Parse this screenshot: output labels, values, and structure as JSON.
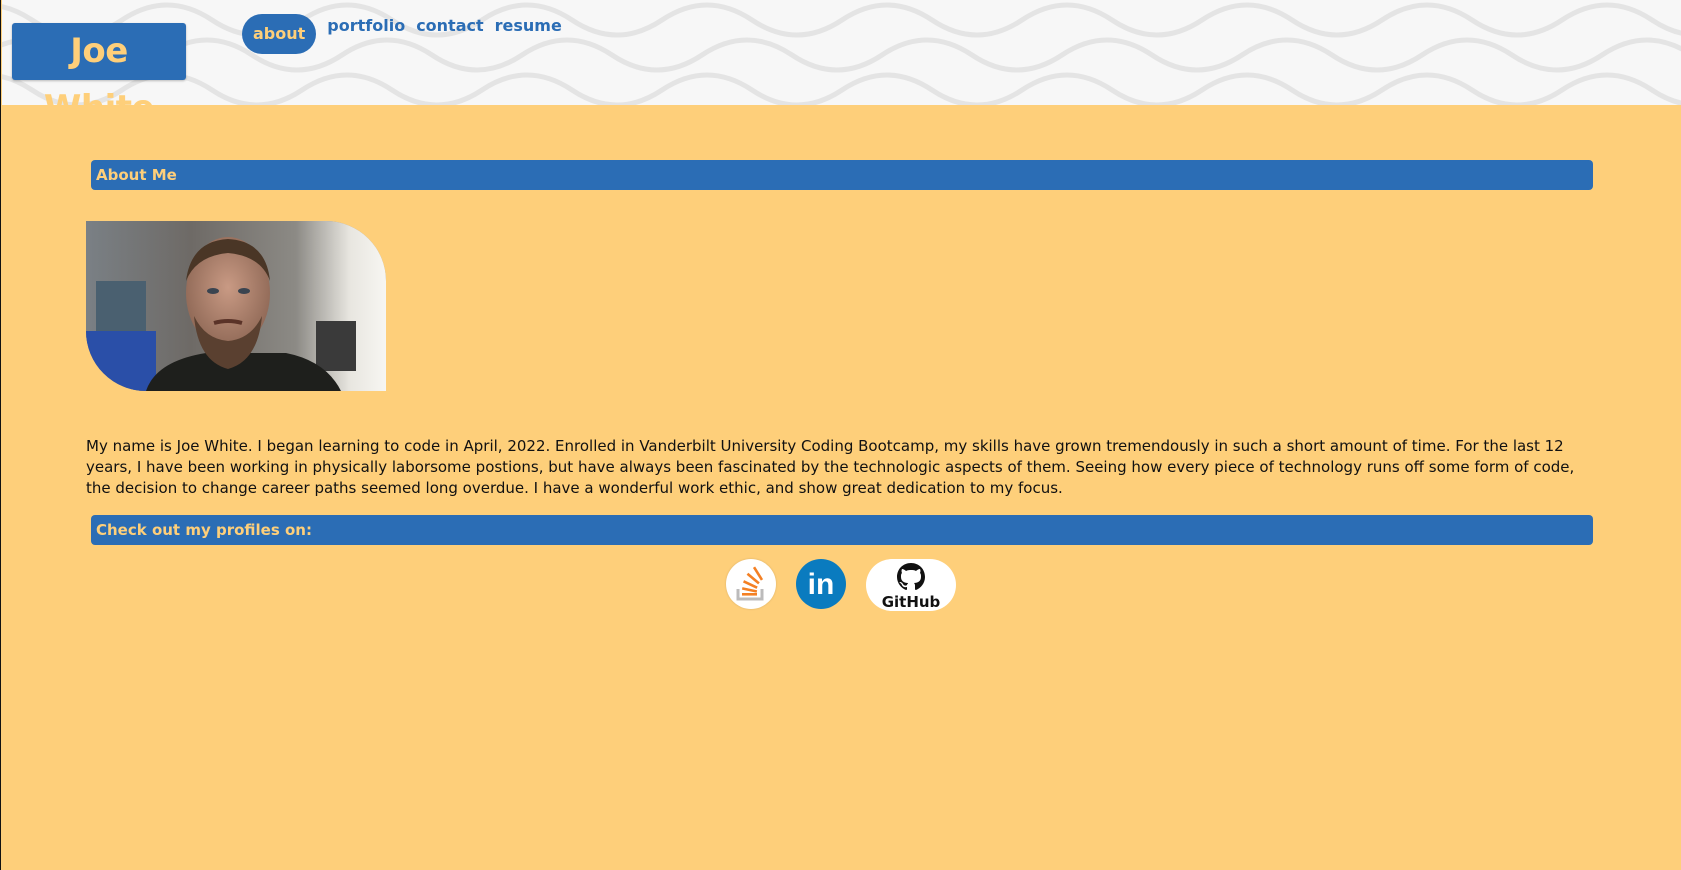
{
  "header": {
    "brand": "Joe White",
    "nav": [
      {
        "label": "about",
        "active": true
      },
      {
        "label": "portfolio",
        "active": false
      },
      {
        "label": "contact",
        "active": false
      },
      {
        "label": "resume",
        "active": false
      }
    ]
  },
  "about": {
    "heading": "About Me",
    "bio": "My name is Joe White. I began learning to code in April, 2022. Enrolled in Vanderbilt University Coding Bootcamp, my skills have grown tremendously in such a short amount of time. For the last 12 years, I have been working in physically laborsome postions, but have always been fascinated by the technologic aspects of them. Seeing how every piece of technology runs off some form of code, the decision to change career paths seemed long overdue. I have a wonderful work ethic, and show great dedication to my focus."
  },
  "profiles": {
    "heading": "Check out my profiles on:",
    "items": [
      {
        "icon": "stackoverflow-icon"
      },
      {
        "icon": "linkedin-icon",
        "text": "in"
      },
      {
        "icon": "github-icon",
        "text": "GitHub"
      }
    ]
  },
  "colors": {
    "background": "#fecf7a",
    "accent": "#2b6db5",
    "header_bg": "#f7f7f7"
  }
}
